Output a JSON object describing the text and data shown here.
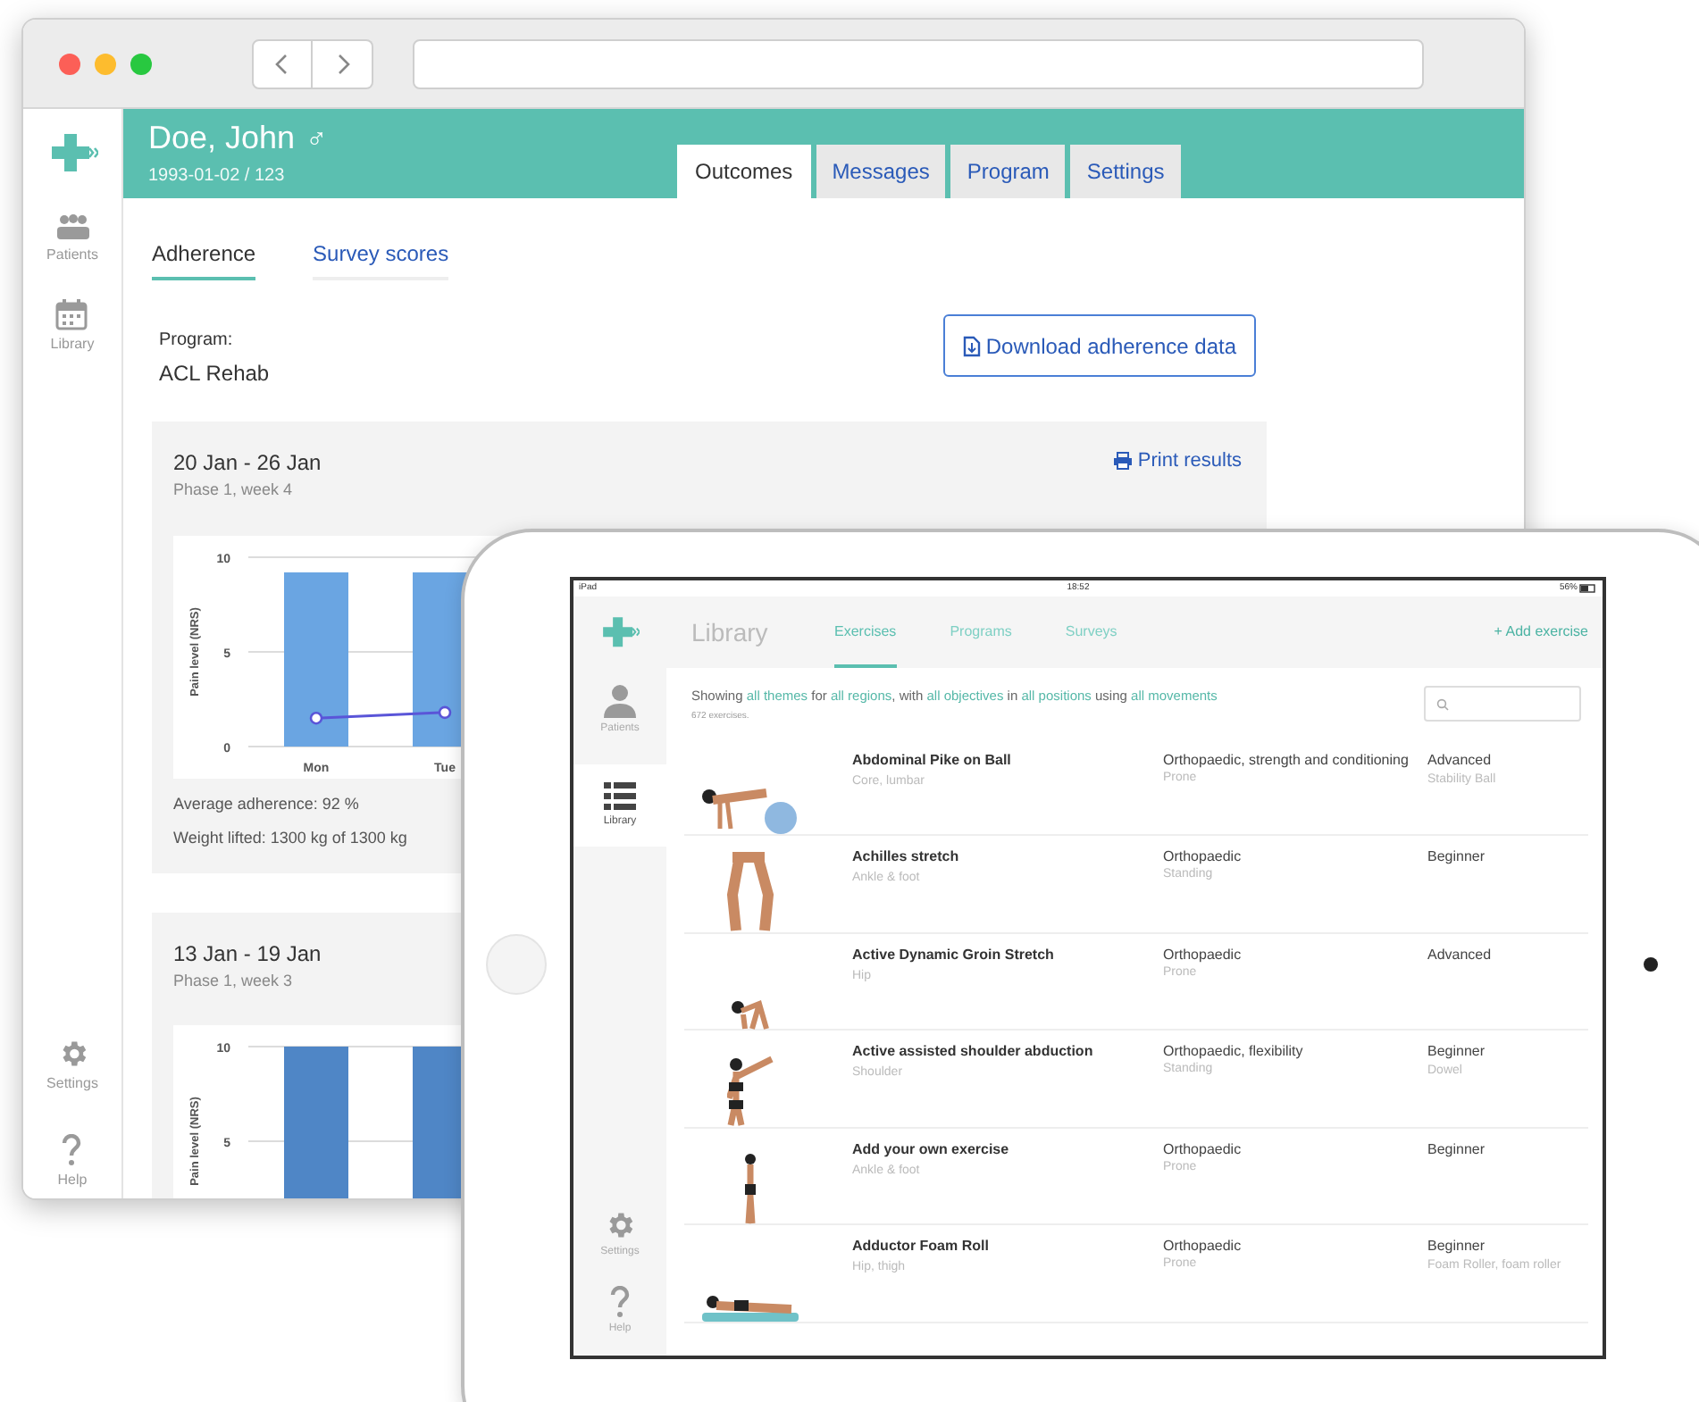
{
  "desktop": {
    "patient": {
      "name": "Doe, John",
      "sex_symbol": "♂",
      "dob_id": "1993-01-02 / 123"
    },
    "sidebar": [
      {
        "label": "Patients"
      },
      {
        "label": "Library"
      },
      {
        "label": "Settings"
      },
      {
        "label": "Help"
      }
    ],
    "tabs": [
      {
        "label": "Outcomes",
        "selected": true
      },
      {
        "label": "Messages",
        "selected": false
      },
      {
        "label": "Program",
        "selected": false
      },
      {
        "label": "Settings",
        "selected": false
      }
    ],
    "subtabs": [
      {
        "label": "Adherence",
        "selected": true
      },
      {
        "label": "Survey scores",
        "selected": false
      }
    ],
    "program_label": "Program:",
    "program_name": "ACL Rehab",
    "download_button": "Download adherence data",
    "weeks": [
      {
        "title": "20 Jan - 26 Jan",
        "phase": "Phase 1, week 4",
        "print": "Print results",
        "stats": [
          "Average adherence: 92 %",
          "Weight lifted: 1300 kg of 1300 kg"
        ],
        "chart_data": {
          "type": "bar",
          "ylabel": "Pain level (NRS)",
          "categories": [
            "Mon",
            "Tue"
          ],
          "yticks": [
            0,
            5,
            10
          ],
          "ylim": [
            0,
            10
          ],
          "series": [
            {
              "type": "bar",
              "color": "#6aa5e2",
              "values": [
                9.2,
                9.2
              ]
            },
            {
              "type": "line",
              "color": "#5a55d8",
              "marker": true,
              "values": [
                1.5,
                1.8
              ]
            }
          ]
        }
      },
      {
        "title": "13 Jan - 19 Jan",
        "phase": "Phase 1, week 3",
        "chart_data": {
          "type": "bar",
          "ylabel": "Pain level (NRS)",
          "yticks": [
            5,
            10
          ],
          "ylim": [
            0,
            10
          ],
          "series": [
            {
              "type": "bar",
              "color": "#4f86c6",
              "values": [
                10,
                10
              ]
            }
          ]
        }
      }
    ]
  },
  "ipad": {
    "status": {
      "device": "iPad",
      "time": "18:52",
      "battery": "56%"
    },
    "title": "Library",
    "tabs": [
      {
        "label": "Exercises",
        "selected": true
      },
      {
        "label": "Programs",
        "selected": false
      },
      {
        "label": "Surveys",
        "selected": false
      }
    ],
    "add_button": "+ Add exercise",
    "sidebar": [
      {
        "label": "Patients",
        "selected": false
      },
      {
        "label": "Library",
        "selected": true
      },
      {
        "label": "Settings",
        "selected": false
      },
      {
        "label": "Help",
        "selected": false
      }
    ],
    "filter": [
      {
        "text": "Showing ",
        "link": false
      },
      {
        "text": "all themes",
        "link": true
      },
      {
        "text": " for ",
        "link": false
      },
      {
        "text": "all regions",
        "link": true
      },
      {
        "text": ", with ",
        "link": false
      },
      {
        "text": "all objectives",
        "link": true
      },
      {
        "text": " in ",
        "link": false
      },
      {
        "text": "all positions",
        "link": true
      },
      {
        "text": " using ",
        "link": false
      },
      {
        "text": "all movements",
        "link": true
      }
    ],
    "count": "672 exercises.",
    "exercises": [
      {
        "name": "Abdominal Pike on Ball",
        "region": "Core, lumbar",
        "category": "Orthopaedic, strength and conditioning",
        "position": "Prone",
        "level": "Advanced",
        "equipment": "Stability Ball"
      },
      {
        "name": "Achilles stretch",
        "region": "Ankle & foot",
        "category": "Orthopaedic",
        "position": "Standing",
        "level": "Beginner"
      },
      {
        "name": "Active Dynamic Groin Stretch",
        "region": "Hip",
        "category": "Orthopaedic",
        "position": "Prone",
        "level": "Advanced"
      },
      {
        "name": "Active assisted shoulder abduction",
        "region": "Shoulder",
        "category": "Orthopaedic, flexibility",
        "position": "Standing",
        "level": "Beginner",
        "equipment": "Dowel"
      },
      {
        "name": "Add your own exercise",
        "region": "Ankle & foot",
        "category": "Orthopaedic",
        "position": "Prone",
        "level": "Beginner"
      },
      {
        "name": "Adductor Foam Roll",
        "region": "Hip, thigh",
        "category": "Orthopaedic",
        "position": "Prone",
        "level": "Beginner",
        "equipment": "Foam Roller, foam roller"
      }
    ]
  }
}
